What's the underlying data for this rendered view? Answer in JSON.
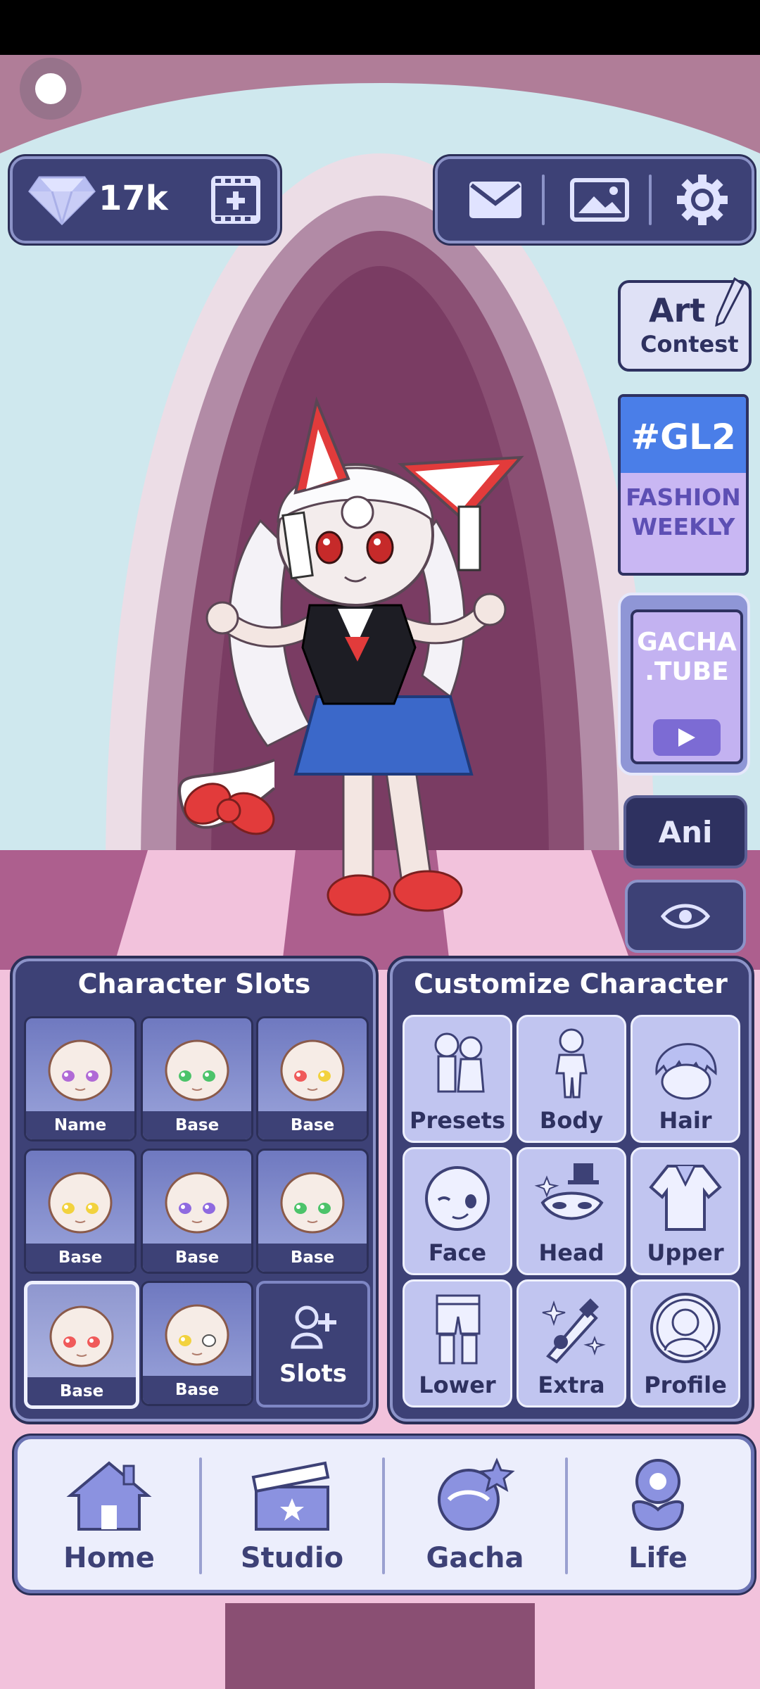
{
  "currency": {
    "value": "17k",
    "gem_icon": "diamond-icon",
    "video_icon": "add-video-icon"
  },
  "top_icons": [
    "mail-icon",
    "gallery-icon",
    "settings-icon"
  ],
  "side": {
    "art_contest": {
      "line1": "Art",
      "line2": "Contest"
    },
    "gl2": {
      "line1": "#GL2",
      "line2": "FASHION",
      "line3": "WEEKLY"
    },
    "tube": {
      "line1": "GACHA",
      "line2": ".TUBE"
    },
    "ani_label": "Ani",
    "eye_icon": "eye-icon"
  },
  "slots": {
    "title": "Character Slots",
    "items": [
      {
        "label": "Name",
        "eye_color": "#b06ad6"
      },
      {
        "label": "Base",
        "eye_color": "#4cc36a"
      },
      {
        "label": "Base",
        "eye_color": "#f05a5a",
        "eye_color_right": "#f2d23e"
      },
      {
        "label": "Base",
        "eye_color": "#f2d23e"
      },
      {
        "label": "Base",
        "eye_color": "#8f6ae0"
      },
      {
        "label": "Base",
        "eye_color": "#4cc36a"
      },
      {
        "label": "Base",
        "eye_color": "#f05a5a",
        "selected": true
      },
      {
        "label": "Base",
        "eye_color": "#f2d23e",
        "eye_color_right": "#ffffff"
      }
    ],
    "add_label": "Slots"
  },
  "customize": {
    "title": "Customize Character",
    "items": [
      "Presets",
      "Body",
      "Hair",
      "Face",
      "Head",
      "Upper",
      "Lower",
      "Extra",
      "Profile"
    ]
  },
  "nav": {
    "items": [
      "Home",
      "Studio",
      "Gacha",
      "Life"
    ]
  },
  "colors": {
    "panel": "#3d4176",
    "panel_border": "#8c93c8",
    "button": "#c1c5f0",
    "accent_red": "#e23b3b"
  }
}
